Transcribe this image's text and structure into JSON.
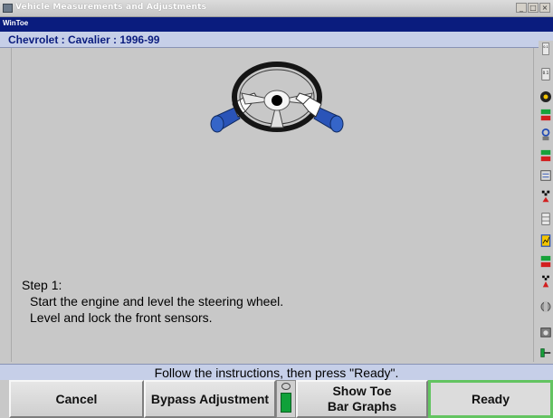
{
  "window": {
    "title": "Vehicle Measurements and Adjustments",
    "controls": [
      "_",
      "□",
      "×"
    ]
  },
  "app": {
    "subtitle": "WinToe"
  },
  "vehicle": {
    "label": "Chevrolet : Cavalier : 1996-99"
  },
  "step": {
    "title": "Step 1:",
    "lines": [
      "Start the engine and level the steering wheel.",
      "Level and lock the front sensors."
    ]
  },
  "prompt": "Follow the instructions, then press \"Ready\".",
  "softkeys": {
    "cancel": "Cancel",
    "bypass": "Bypass Adjustment",
    "show_toe": [
      "Show Toe",
      "Bar Graphs"
    ],
    "ready": "Ready"
  },
  "side_toolbar": {
    "icons": [
      "spec-readout-icon",
      "spec-readout-icon",
      "wheel-icon",
      "measurement-icon",
      "sensor-icon",
      "measurement-icon",
      "spec-icon",
      "checkered-flag-icon",
      "grid-icon",
      "chart-icon",
      "measurement-icon",
      "checkered-flag-icon",
      "tool-icon",
      "camera-icon",
      "sensor-icon"
    ],
    "readouts": [
      "0.1",
      "0.1"
    ]
  },
  "colors": {
    "title_blue": "#0a1c7e",
    "vehicle_bar": "#c6cfe8",
    "ready_border": "#63c461",
    "lamp_green": "#10a13a"
  }
}
